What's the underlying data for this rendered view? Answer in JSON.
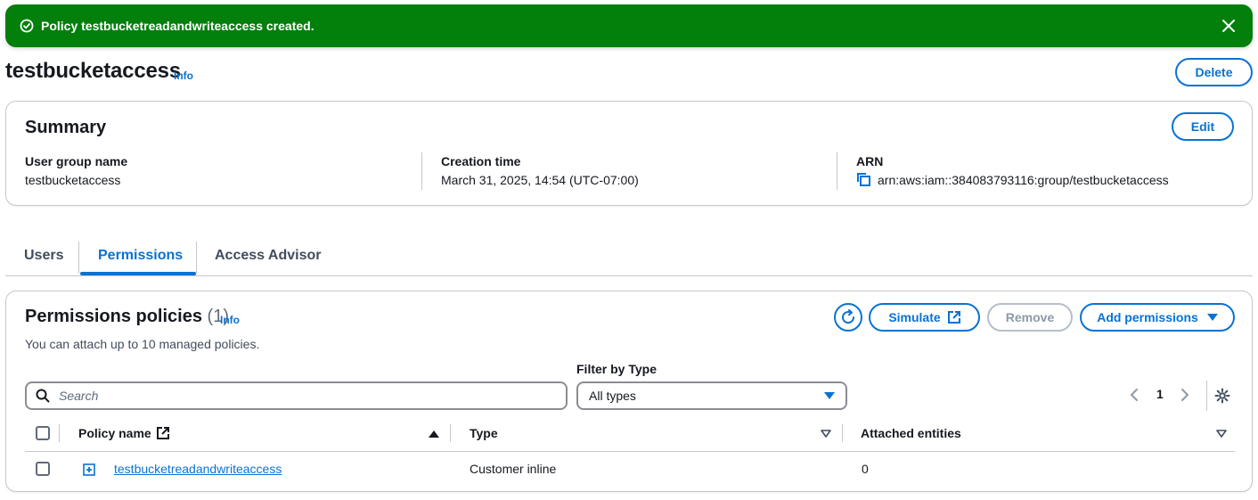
{
  "flash": {
    "message": "Policy testbucketreadandwriteaccess created.",
    "icon": "check-circle-icon",
    "close_icon": "close-icon",
    "color": "#037f0c"
  },
  "header": {
    "title": "testbucketaccess",
    "info": "Info",
    "delete_label": "Delete"
  },
  "summary": {
    "title": "Summary",
    "edit_label": "Edit",
    "fields": [
      {
        "label": "User group name",
        "value": "testbucketaccess"
      },
      {
        "label": "Creation time",
        "value": "March 31, 2025, 14:54 (UTC-07:00)"
      },
      {
        "label": "ARN",
        "value": "arn:aws:iam::384083793116:group/testbucketaccess",
        "icon": "copy-icon"
      }
    ]
  },
  "tabs": [
    {
      "label": "Users",
      "active": false
    },
    {
      "label": "Permissions",
      "active": true
    },
    {
      "label": "Access Advisor",
      "active": false
    }
  ],
  "permissions": {
    "title": "Permissions policies",
    "count": "(1)",
    "info": "Info",
    "description": "You can attach up to 10 managed policies.",
    "simulate_label": "Simulate",
    "remove_label": "Remove",
    "add_label": "Add permissions",
    "filter_label": "Filter by Type",
    "search_placeholder": "Search",
    "filter_value": "All types",
    "page": "1",
    "columns": [
      "Policy name",
      "Type",
      "Attached entities"
    ],
    "rows": [
      {
        "name": "testbucketreadandwriteaccess",
        "type": "Customer inline",
        "attached": "0"
      }
    ]
  },
  "colors": {
    "accent": "#0972d3",
    "success": "#037f0c",
    "border": "#c6c6cd",
    "disabled": "#8d99a8"
  }
}
